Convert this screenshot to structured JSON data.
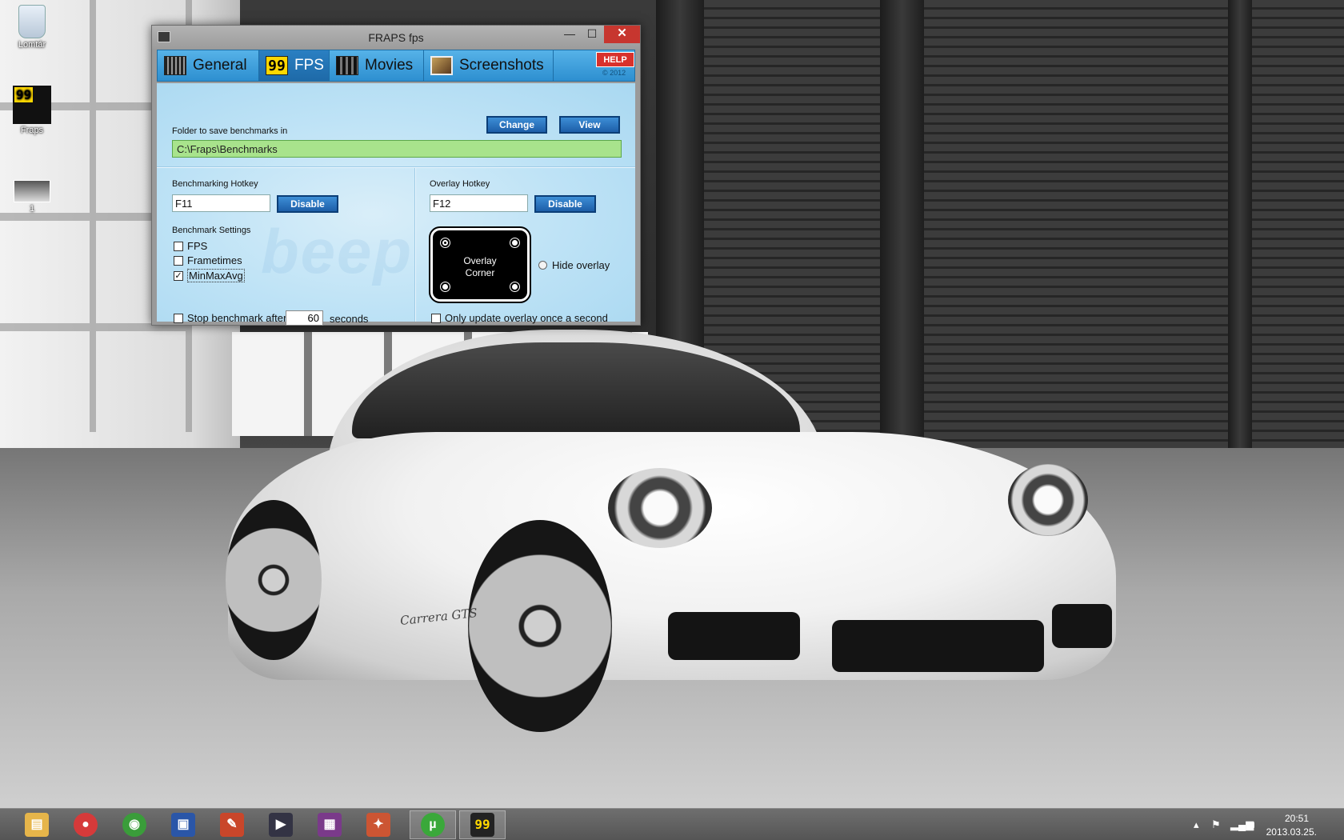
{
  "desktop": {
    "icons": [
      {
        "label": "Lomtár",
        "icon": "recycle-bin-icon"
      },
      {
        "label": "Fraps",
        "icon": "fraps-shortcut-icon",
        "badge": "99"
      },
      {
        "label": "1",
        "icon": "image-file-icon"
      }
    ],
    "wallpaper_text": "Carrera GTS"
  },
  "window": {
    "title": "FRAPS fps",
    "controls": {
      "minimize": "—",
      "maximize": "☐",
      "close": "✕"
    },
    "tabs": [
      {
        "label": "General",
        "icon": "general-grid-icon",
        "active": false
      },
      {
        "label": "FPS",
        "icon": "fps-99-icon",
        "icon_text": "99",
        "active": true
      },
      {
        "label": "Movies",
        "icon": "movies-film-icon",
        "active": false
      },
      {
        "label": "Screenshots",
        "icon": "screenshots-photo-icon",
        "active": false
      }
    ],
    "help_label": "HELP",
    "copyright": "© 2012",
    "watermark": "beep"
  },
  "fps_page": {
    "folder_label": "Folder to save benchmarks in",
    "folder_value": "C:\\Fraps\\Benchmarks",
    "change_label": "Change",
    "view_label": "View",
    "bench_hotkey_label": "Benchmarking Hotkey",
    "bench_hotkey_value": "F11",
    "bench_disable_label": "Disable",
    "overlay_hotkey_label": "Overlay Hotkey",
    "overlay_hotkey_value": "F12",
    "overlay_disable_label": "Disable",
    "settings_label": "Benchmark Settings",
    "settings": [
      {
        "label": "FPS",
        "checked": false
      },
      {
        "label": "Frametimes",
        "checked": false
      },
      {
        "label": "MinMaxAvg",
        "checked": true
      }
    ],
    "overlay_corner_line1": "Overlay",
    "overlay_corner_line2": "Corner",
    "hide_overlay_label": "Hide overlay",
    "stop_after_label": "Stop benchmark after",
    "stop_after_value": "60",
    "seconds_label": "seconds",
    "only_update_label": "Only update overlay once a second"
  },
  "taskbar": {
    "apps": [
      {
        "name": "file-explorer-icon",
        "glyph": "▤",
        "color": "#e6b54a"
      },
      {
        "name": "app-red-circle-icon",
        "glyph": "●",
        "color": "#d63a3a"
      },
      {
        "name": "chrome-icon",
        "glyph": "◉",
        "color": "#3a9d3a"
      },
      {
        "name": "floppy-save-icon",
        "glyph": "▣",
        "color": "#2a56a8"
      },
      {
        "name": "pdf-tool-icon",
        "glyph": "✎",
        "color": "#c9462a"
      },
      {
        "name": "video-pro-icon",
        "glyph": "▶",
        "color": "#334"
      },
      {
        "name": "winrar-icon",
        "glyph": "▦",
        "color": "#7a3a8a"
      },
      {
        "name": "tools-icon",
        "glyph": "✦",
        "color": "#c53"
      },
      {
        "name": "utorrent-icon",
        "glyph": "µ",
        "color": "#3aa83a"
      },
      {
        "name": "fraps-taskbar-icon",
        "glyph": "99",
        "color": "#222"
      }
    ],
    "clock_time": "20:51",
    "clock_date": "2013.03.25."
  }
}
